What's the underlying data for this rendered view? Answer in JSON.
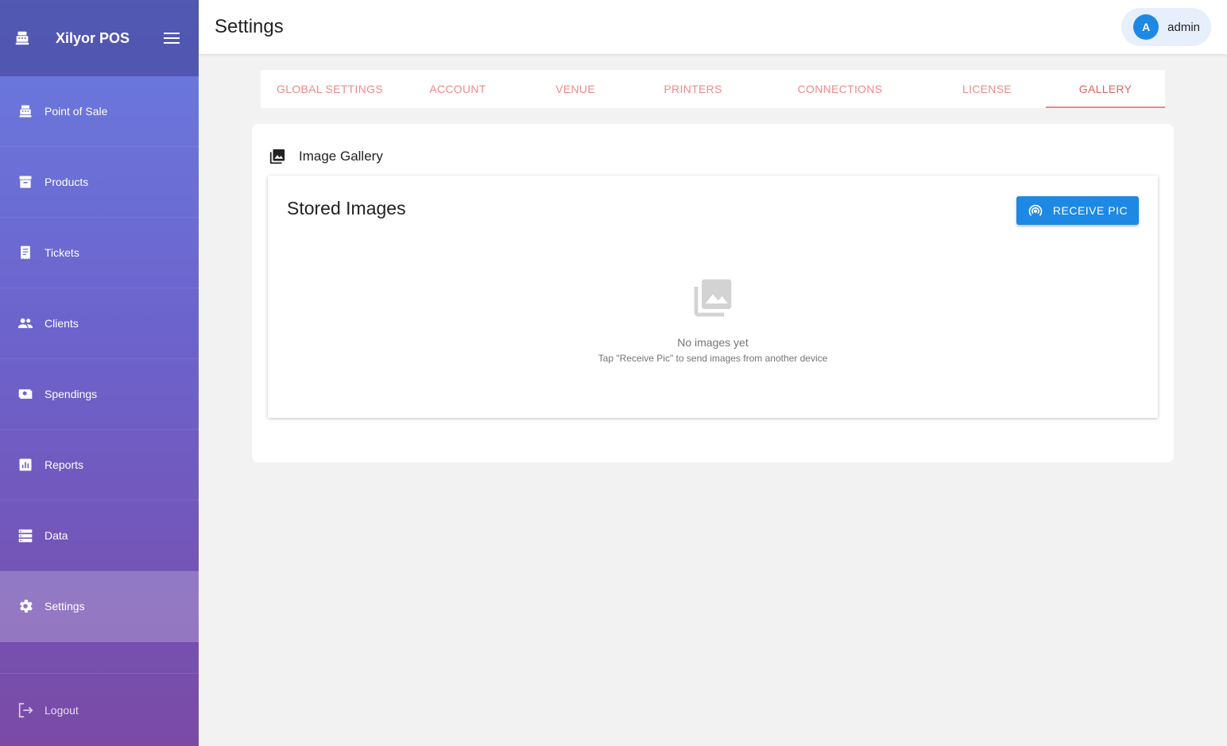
{
  "sidebar": {
    "brand": "Xilyor POS",
    "brand_icon": "cash-register-icon",
    "items": [
      {
        "label": "Point of Sale",
        "icon": "cash-register-icon"
      },
      {
        "label": "Products",
        "icon": "archive-box-icon"
      },
      {
        "label": "Tickets",
        "icon": "receipt-icon"
      },
      {
        "label": "Clients",
        "icon": "people-icon"
      },
      {
        "label": "Spendings",
        "icon": "cash-icon"
      },
      {
        "label": "Reports",
        "icon": "bar-chart-icon"
      },
      {
        "label": "Data",
        "icon": "database-icon"
      },
      {
        "label": "Settings",
        "icon": "gear-icon",
        "active": true
      }
    ],
    "logout": "Logout"
  },
  "topbar": {
    "title": "Settings",
    "user": {
      "initial": "A",
      "name": "admin"
    }
  },
  "tabs": [
    {
      "label": "GLOBAL SETTINGS"
    },
    {
      "label": "ACCOUNT"
    },
    {
      "label": "VENUE"
    },
    {
      "label": "PRINTERS"
    },
    {
      "label": "CONNECTIONS"
    },
    {
      "label": "LICENSE"
    },
    {
      "label": "GALLERY",
      "active": true
    }
  ],
  "gallery": {
    "title": "Image Gallery",
    "stored_title": "Stored Images",
    "receive_button": "RECEIVE PIC",
    "empty_title": "No images yet",
    "empty_hint": "Tap \"Receive Pic\" to send images from another device"
  },
  "colors": {
    "accent": "#1e88e5",
    "tab_text": "#ef8a8a",
    "sidebar_top": "#6a7ce0",
    "sidebar_bottom": "#7a4aa6"
  }
}
